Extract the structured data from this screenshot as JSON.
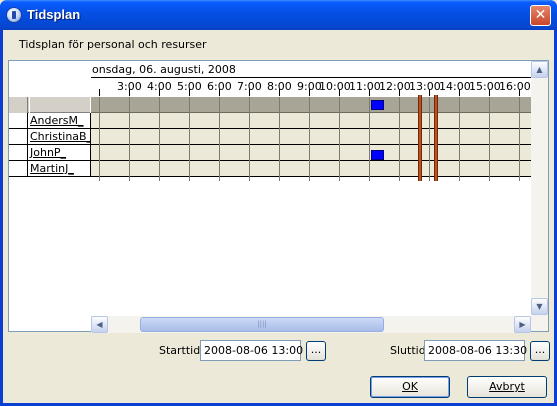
{
  "window": {
    "title": "Tidsplan",
    "close_label": "✕"
  },
  "heading": "Tidsplan för personal och resurser",
  "schedule": {
    "date_label": "onsdag, 06. augusti, 2008",
    "hours": [
      "3:00",
      "4:00",
      "5:00",
      "6:00",
      "7:00",
      "8:00",
      "9:00",
      "10:00",
      "11:00",
      "12:00",
      "13:00",
      "14:00",
      "15:00",
      "16:00"
    ],
    "rows": [
      {
        "name": "AndersM_"
      },
      {
        "name": "ChristinaB_"
      },
      {
        "name": "JohnP_"
      },
      {
        "name": "MartinJ_"
      }
    ]
  },
  "scroll": {
    "up": "▲",
    "down": "▼",
    "left": "◀",
    "right": "▶",
    "grip": "||||"
  },
  "form": {
    "start_label": "Starttid",
    "start_value": "2008-08-06 13:00",
    "end_label": "Sluttid",
    "end_value": "2008-08-06 13:30",
    "picker_label": "..."
  },
  "buttons": {
    "ok": "OK",
    "cancel": "Avbryt"
  }
}
